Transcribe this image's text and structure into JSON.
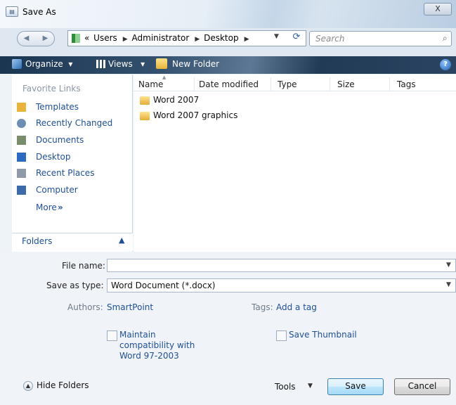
{
  "window": {
    "title": "Save As",
    "close_label": "X"
  },
  "address": {
    "breadcrumb": [
      "«",
      "Users",
      "Administrator",
      "Desktop"
    ],
    "search_placeholder": "Search"
  },
  "toolbar": {
    "organize": "Organize",
    "views": "Views",
    "new_folder": "New Folder",
    "help": "?"
  },
  "nav": {
    "heading": "Favorite Links",
    "items": [
      {
        "label": "Templates",
        "icon": "folder-icon",
        "color": "#e9b43b"
      },
      {
        "label": "Recently Changed",
        "icon": "recent-icon",
        "color": "#6e8fb4"
      },
      {
        "label": "Documents",
        "icon": "documents-icon",
        "color": "#7a8d6a"
      },
      {
        "label": "Desktop",
        "icon": "desktop-icon",
        "color": "#2a6bc0"
      },
      {
        "label": "Recent Places",
        "icon": "recent-places-icon",
        "color": "#8e9aa8"
      },
      {
        "label": "Computer",
        "icon": "computer-icon",
        "color": "#3b6aa8"
      }
    ],
    "more": "More",
    "folders": "Folders"
  },
  "columns": [
    "Name",
    "Date modified",
    "Type",
    "Size",
    "Tags"
  ],
  "files": [
    {
      "name": "Word 2007"
    },
    {
      "name": "Word 2007 graphics"
    }
  ],
  "form": {
    "filename_label": "File name:",
    "filename_value": "",
    "savetype_label": "Save as type:",
    "savetype_value": "Word Document (*.docx)",
    "authors_label": "Authors:",
    "authors_value": "SmartPoint",
    "tags_label": "Tags:",
    "tags_value": "Add a tag",
    "compat_line1": "Maintain",
    "compat_line2": "compatibility with",
    "compat_line3": "Word 97-2003",
    "thumbnail_label": "Save Thumbnail"
  },
  "footer": {
    "hide_folders": "Hide Folders",
    "tools": "Tools",
    "save": "Save",
    "cancel": "Cancel"
  }
}
